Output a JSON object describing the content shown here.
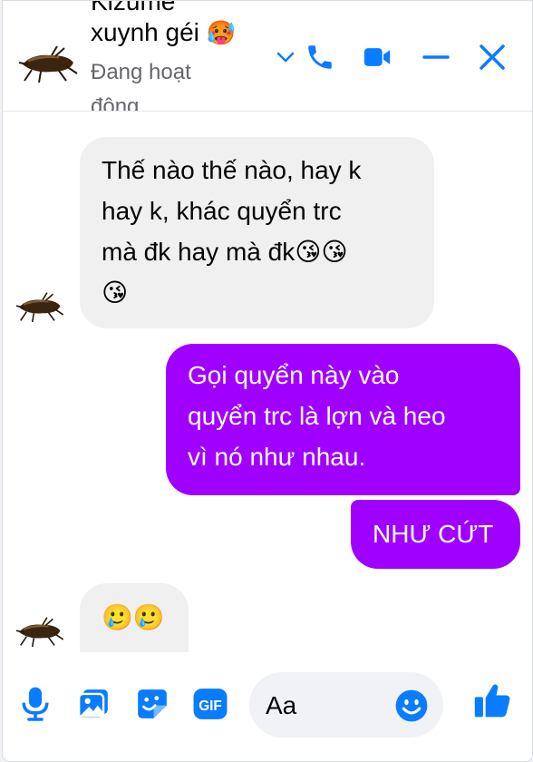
{
  "header": {
    "name_line1": "Kizume",
    "name_line2": "xuynh géi",
    "name_emoji": "🥵",
    "status": "Đang hoạt động",
    "icons": [
      "chevron-down-icon",
      "phone-icon",
      "video-camera-icon",
      "minimize-icon",
      "close-icon"
    ]
  },
  "messages": [
    {
      "direction": "incoming",
      "text": "Thế nào thế nào, hay k\nhay k, khác quyển trc\nmà đk hay mà đk😘😘\n😘"
    },
    {
      "direction": "outgoing",
      "text": "Gọi quyển này vào\nquyển trc là lợn và heo\nvì nó như nhau."
    },
    {
      "direction": "outgoing",
      "text": "NHƯ CỨT"
    },
    {
      "direction": "incoming",
      "text": "🥲🥲"
    }
  ],
  "composer": {
    "placeholder": "Aa",
    "icons": [
      "microphone-icon",
      "image-icon",
      "sticker-icon",
      "gif-icon",
      "emoji-icon",
      "thumbs-up-icon"
    ],
    "gif_label": "GIF"
  },
  "colors": {
    "accent": "#0a7cff",
    "outgoing_bubble": "#a000ff",
    "incoming_bubble": "#f0f0f0"
  }
}
